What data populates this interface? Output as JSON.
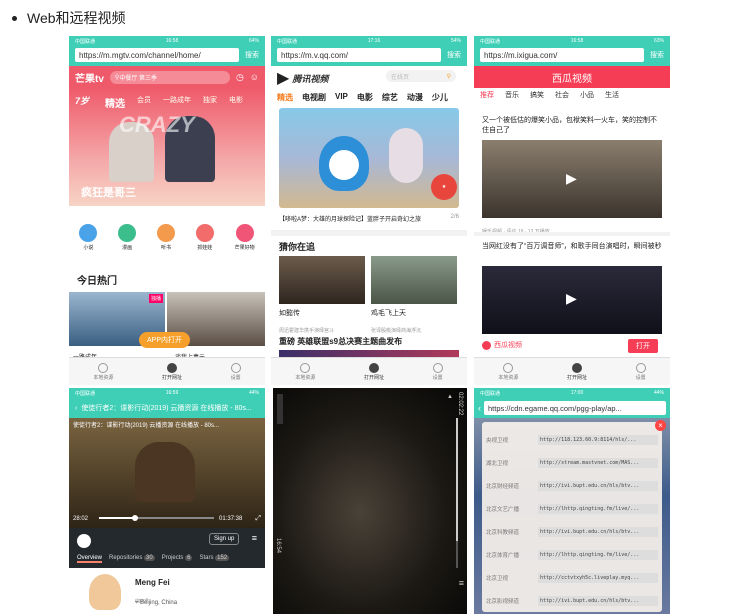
{
  "heading": "Web和远程视频",
  "status": {
    "carrier": "中国联通",
    "battery": "64%",
    "batt2": "54%",
    "batt3": "63%",
    "batt4": "44%",
    "batt5": "44%",
    "t1": "16:58",
    "t2": "17:16",
    "t3": "16:58",
    "t4": "16:59",
    "t5": "17:00"
  },
  "go": "搜索",
  "nav": {
    "local": "本地资源",
    "open": "打开网址",
    "settings": "设置"
  },
  "p1": {
    "url": "https://m.mgtv.com/channel/home/",
    "logo": "芒果tv",
    "search": "中餐厅 第三季",
    "tabs": [
      "精选",
      "会员",
      "一路成年",
      "独家",
      "电影"
    ],
    "age": "7岁",
    "hero_title": "疯狂是哥三",
    "icons": [
      "小说",
      "漫画",
      "听书",
      "抓娃娃",
      "芒果好物"
    ],
    "hot": "今日热门",
    "tag": "独播",
    "cap1": "一路成年",
    "cap2": "谈我上毒元",
    "app": "APP内打开"
  },
  "p2": {
    "url": "https://m.v.qq.com/",
    "logo": "腾讯视频",
    "search": "在线页",
    "tabs": [
      "精选",
      "电视剧",
      "VIP",
      "电影",
      "综艺",
      "动漫",
      "少儿"
    ],
    "banner_cap": "【哆啦A梦：大雄的月球探险记】蓝胖子开启奇幻之旅",
    "page": "2/6",
    "section": "猜你在追",
    "c1": "如懿传",
    "c1s": "周迅霍建华携手演绎宫斗",
    "c2": "鸡毛飞上天",
    "c2s": "张译殷桃演绎商海浮沉",
    "promo": "重磅 英雄联盟s9总决赛主题曲发布"
  },
  "p3": {
    "url": "https://m.ixigua.com/",
    "title": "西瓜视频",
    "tabs": [
      "推荐",
      "音乐",
      "搞笑",
      "社会",
      "小品",
      "生活"
    ],
    "v1": "又一个被低估的爆笑小品，包袱笑料一火车，笑的控制不住自己了",
    "v1m": "娱乐视频 · 评论 19 · 12 万播放",
    "v2": "当网红没有了“百万调音师”，和歌手同台演唱时，瞬间被秒",
    "brand": "西瓜视频",
    "open": "打开"
  },
  "p4": {
    "title": "使徒行者2：谍影行动(2019) 云播资源 在线播放 - 80s...",
    "title2": "使徒行者2：谍影行动(2019) 云播资源 在线播放 - 80s...",
    "t_cur": "28:02",
    "t_end": "01:37:38",
    "signup": "Sign up",
    "tabs": [
      "Overview",
      "Repositories",
      "Projects",
      "Stars"
    ],
    "counts": [
      "30",
      "6",
      "152"
    ],
    "name": "Meng Fei",
    "user": "dgynfi",
    "loc": "Beijing, China"
  },
  "p5": {
    "time_left": "16:54",
    "time_right": "02:02:22",
    "progress": 0.82
  },
  "p6": {
    "url": "https://cdn.egame.qq.com/pgg-play/ap...",
    "rows": [
      [
        "央视卫视",
        "http://118.123.60.9:8114/hls/..."
      ],
      [
        "湖北卫视",
        "http://stream.mastvnet.com/MAS..."
      ],
      [
        "北京财经频道",
        "http://ivi.bupt.edu.cn/hls/btv..."
      ],
      [
        "北京文艺广播",
        "http://lhttp.qingting.fm/live/..."
      ],
      [
        "北京科教频道",
        "http://ivi.bupt.edu.cn/hls/btv..."
      ],
      [
        "北京体育广播",
        "http://lhttp.qingting.fm/live/..."
      ],
      [
        "北京卫视",
        "http://cctvtxyh5c.liveplay.myq..."
      ],
      [
        "北京影视频道",
        "http://ivi.bupt.edu.cn/hls/btv..."
      ]
    ]
  }
}
